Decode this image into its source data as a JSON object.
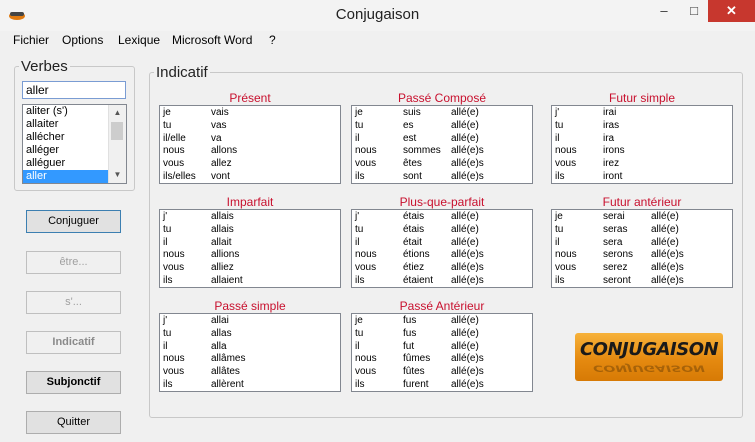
{
  "window": {
    "title": "Conjugaison",
    "minimize": "–",
    "maximize": "□",
    "close": "✕"
  },
  "menu": [
    "Fichier",
    "Options",
    "Lexique",
    "Microsoft Word",
    "?"
  ],
  "verbes": {
    "legend": "Verbes",
    "search_value": "aller",
    "list": [
      "aliter (s')",
      "allaiter",
      "allécher",
      "alléger",
      "alléguer",
      "aller"
    ],
    "selected_index": 5
  },
  "buttons": {
    "conjuguer": "Conjuguer",
    "etre": "être...",
    "se": "s'...",
    "indicatif": "Indicatif",
    "subjonctif": "Subjonctif",
    "quitter": "Quitter"
  },
  "indicatif": {
    "legend": "Indicatif",
    "tenses": [
      {
        "title": "Présent",
        "rows": [
          [
            "je",
            "vais"
          ],
          [
            "tu",
            "vas"
          ],
          [
            "il/elle",
            "va"
          ],
          [
            "nous",
            "allons"
          ],
          [
            "vous",
            "allez"
          ],
          [
            "ils/elles",
            "vont"
          ]
        ]
      },
      {
        "title": "Passé Composé",
        "rows": [
          [
            "je",
            "suis",
            "allé(e)"
          ],
          [
            "tu",
            "es",
            "allé(e)"
          ],
          [
            "il",
            "est",
            "allé(e)"
          ],
          [
            "nous",
            "sommes",
            "allé(e)s"
          ],
          [
            "vous",
            "êtes",
            "allé(e)s"
          ],
          [
            "ils",
            "sont",
            "allé(e)s"
          ]
        ]
      },
      {
        "title": "Futur simple",
        "rows": [
          [
            "j'",
            "irai"
          ],
          [
            "tu",
            "iras"
          ],
          [
            "il",
            "ira"
          ],
          [
            "nous",
            "irons"
          ],
          [
            "vous",
            "irez"
          ],
          [
            "ils",
            "iront"
          ]
        ]
      },
      {
        "title": "Imparfait",
        "rows": [
          [
            "j'",
            "allais"
          ],
          [
            "tu",
            "allais"
          ],
          [
            "il",
            "allait"
          ],
          [
            "nous",
            "allions"
          ],
          [
            "vous",
            "alliez"
          ],
          [
            "ils",
            "allaient"
          ]
        ]
      },
      {
        "title": "Plus-que-parfait",
        "rows": [
          [
            "j'",
            "étais",
            "allé(e)"
          ],
          [
            "tu",
            "étais",
            "allé(e)"
          ],
          [
            "il",
            "était",
            "allé(e)"
          ],
          [
            "nous",
            "étions",
            "allé(e)s"
          ],
          [
            "vous",
            "étiez",
            "allé(e)s"
          ],
          [
            "ils",
            "étaient",
            "allé(e)s"
          ]
        ]
      },
      {
        "title": "Futur antérieur",
        "rows": [
          [
            "je",
            "serai",
            "allé(e)"
          ],
          [
            "tu",
            "seras",
            "allé(e)"
          ],
          [
            "il",
            "sera",
            "allé(e)"
          ],
          [
            "nous",
            "serons",
            "allé(e)s"
          ],
          [
            "vous",
            "serez",
            "allé(e)s"
          ],
          [
            "ils",
            "seront",
            "allé(e)s"
          ]
        ]
      },
      {
        "title": "Passé simple",
        "rows": [
          [
            "j'",
            "allai"
          ],
          [
            "tu",
            "allas"
          ],
          [
            "il",
            "alla"
          ],
          [
            "nous",
            "allâmes"
          ],
          [
            "vous",
            "allâtes"
          ],
          [
            "ils",
            "allèrent"
          ]
        ]
      },
      {
        "title": "Passé Antérieur",
        "rows": [
          [
            "je",
            "fus",
            "allé(e)"
          ],
          [
            "tu",
            "fus",
            "allé(e)"
          ],
          [
            "il",
            "fut",
            "allé(e)"
          ],
          [
            "nous",
            "fûmes",
            "allé(e)s"
          ],
          [
            "vous",
            "fûtes",
            "allé(e)s"
          ],
          [
            "ils",
            "furent",
            "allé(e)s"
          ]
        ]
      }
    ]
  },
  "logo": {
    "text": "CONJUGAISON"
  }
}
